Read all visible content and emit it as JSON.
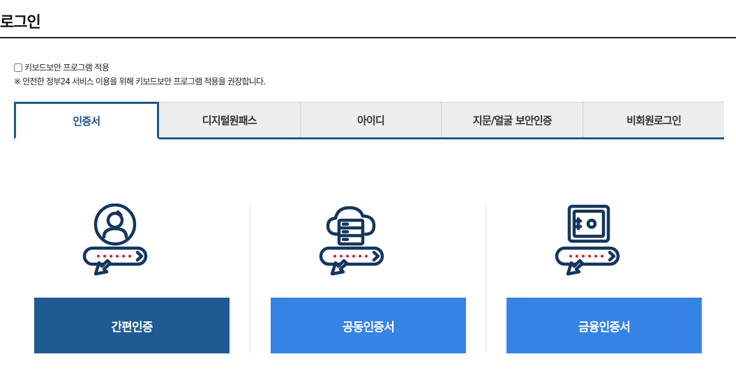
{
  "page": {
    "title": "로그인"
  },
  "keyboard_security": {
    "checkbox_label": "키보드보안 프로그램 적용",
    "checked": false,
    "notice": "※ 안전한 정부24 서비스 이용을 위해 키보드보안 프로그램 적용을 권장합니다."
  },
  "tabs": [
    {
      "label": "인증서",
      "active": true
    },
    {
      "label": "디지털원패스",
      "active": false
    },
    {
      "label": "아이디",
      "active": false
    },
    {
      "label": "지문/얼굴 보안인증",
      "active": false
    },
    {
      "label": "비회원로그인",
      "active": false
    }
  ],
  "auth_options": [
    {
      "label": "간편인증",
      "icon": "user-password-icon",
      "color": "#1d5b91"
    },
    {
      "label": "공동인증서",
      "icon": "cloud-server-password-icon",
      "color": "#3483e5"
    },
    {
      "label": "금융인증서",
      "icon": "safe-password-icon",
      "color": "#3483e5"
    }
  ],
  "colors": {
    "primary_dark": "#1d5b91",
    "primary_light": "#3483e5",
    "icon_stroke": "#14365e",
    "password_dots": "#d6202c"
  }
}
